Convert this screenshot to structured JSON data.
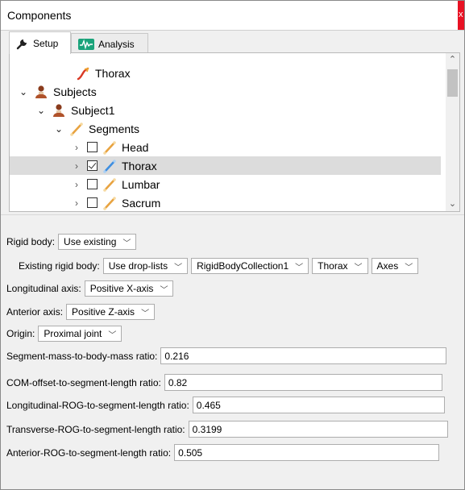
{
  "window": {
    "title": "Components",
    "close_label": "x"
  },
  "tabs": [
    {
      "label": "Setup",
      "icon": "wrench-icon",
      "active": true
    },
    {
      "label": "Analysis",
      "icon": "waveform-icon",
      "active": false
    }
  ],
  "tree": {
    "rows": [
      {
        "label": "Thorax",
        "icon": "segment-curve-icon"
      },
      {
        "label": "Subjects",
        "icon": "subject-bust-icon",
        "expanded": true
      },
      {
        "label": "Subject1",
        "icon": "subject-bust-icon",
        "expanded": true
      },
      {
        "label": "Segments",
        "icon": "bone-icon",
        "expanded": true
      },
      {
        "label": "Head",
        "icon": "bone-icon",
        "checked": false
      },
      {
        "label": "Thorax",
        "icon": "bone-icon",
        "checked": true,
        "selected": true
      },
      {
        "label": "Lumbar",
        "icon": "bone-icon",
        "checked": false
      },
      {
        "label": "Sacrum",
        "icon": "bone-icon",
        "checked": false
      }
    ]
  },
  "form": {
    "rigid_body": {
      "label": "Rigid body:",
      "value": "Use existing"
    },
    "existing_rigid_body": {
      "label": "Existing rigid body:",
      "mode": "Use drop-lists",
      "collection": "RigidBodyCollection1",
      "segment": "Thorax",
      "axes": "Axes"
    },
    "longitudinal_axis": {
      "label": "Longitudinal axis:",
      "value": "Positive X-axis"
    },
    "anterior_axis": {
      "label": "Anterior axis:",
      "value": "Positive Z-axis"
    },
    "origin": {
      "label": "Origin:",
      "value": "Proximal joint"
    },
    "segment_mass_ratio": {
      "label": "Segment-mass-to-body-mass ratio:",
      "value": "0.216"
    },
    "com_offset_ratio": {
      "label": "COM-offset-to-segment-length ratio:",
      "value": "0.82"
    },
    "longitudinal_rog_ratio": {
      "label": "Longitudinal-ROG-to-segment-length ratio:",
      "value": "0.465"
    },
    "transverse_rog_ratio": {
      "label": "Transverse-ROG-to-segment-length ratio:",
      "value": "0.3199"
    },
    "anterior_rog_ratio": {
      "label": "Anterior-ROG-to-segment-length ratio:",
      "value": "0.505"
    }
  }
}
